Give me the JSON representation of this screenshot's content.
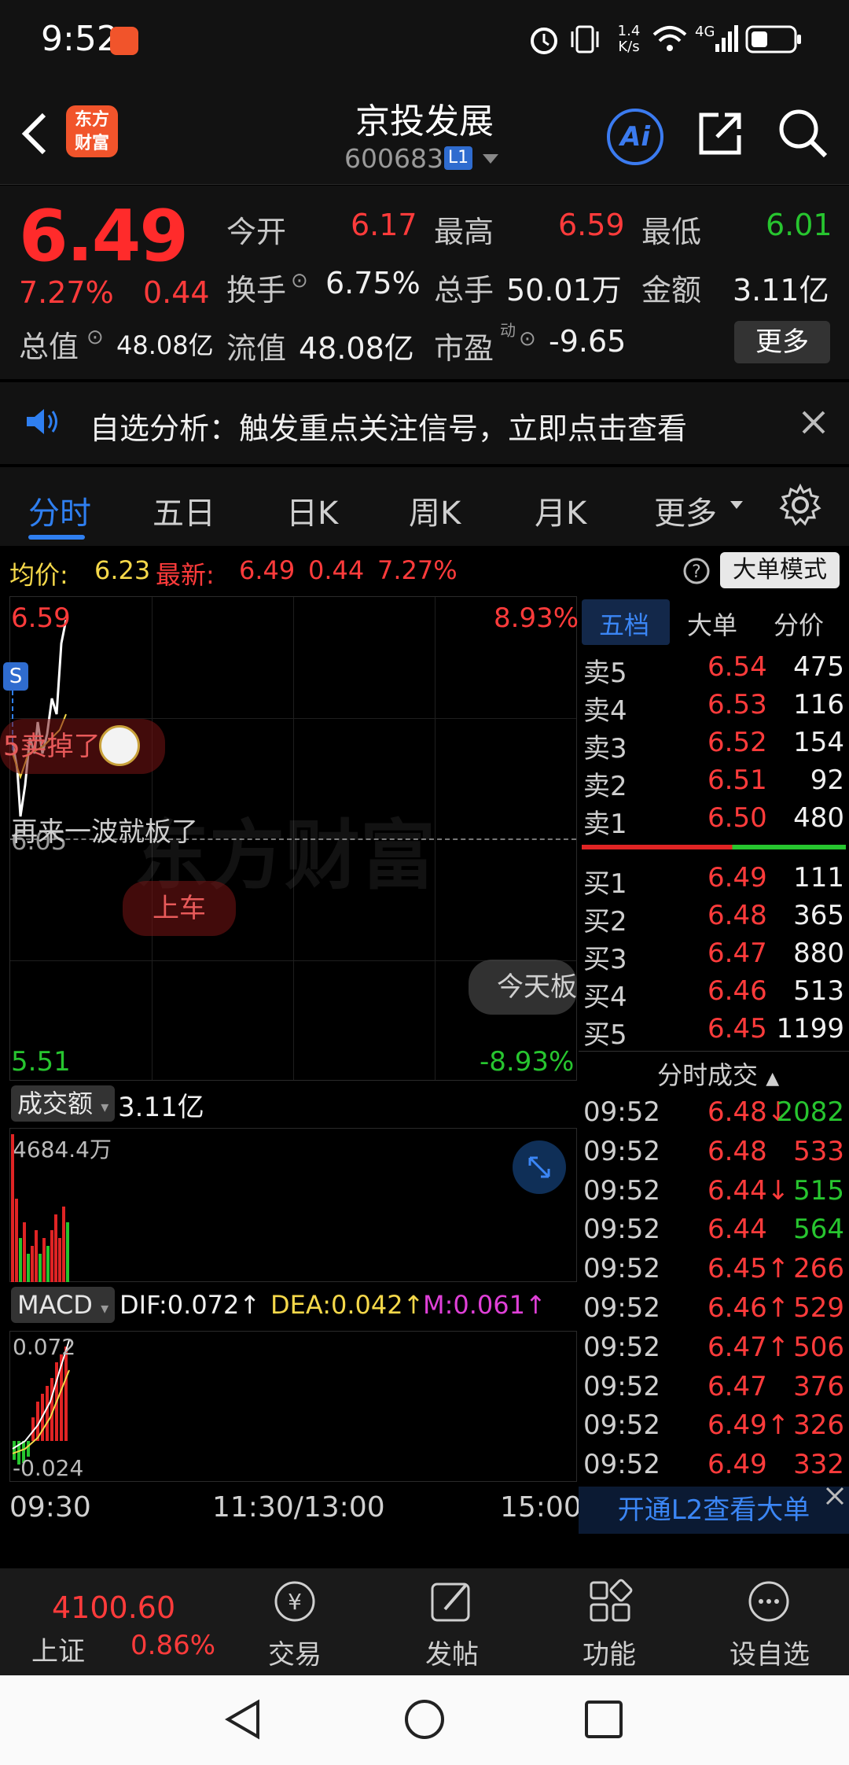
{
  "status_bar": {
    "time": "9:52",
    "net_speed_top": "1.4",
    "net_speed_bottom": "K/s",
    "network": "4G"
  },
  "header": {
    "logo_line1": "东方",
    "logo_line2": "财富",
    "title": "京投发展",
    "code": "600683",
    "level_badge": "L1",
    "ai_label": "Ai"
  },
  "quote": {
    "price": "6.49",
    "change_pct": "7.27%",
    "change": "0.44",
    "open_label": "今开",
    "open": "6.17",
    "high_label": "最高",
    "high": "6.59",
    "low_label": "最低",
    "low": "6.01",
    "turnover_label": "换手",
    "turnover": "6.75%",
    "volume_label": "总手",
    "volume": "50.01万",
    "amount_label": "金额",
    "amount": "3.11亿",
    "mktcap_label": "总值",
    "mktcap": "48.08亿",
    "float_label": "流值",
    "float": "48.08亿",
    "pe_label": "市盈",
    "pe_sup": "动",
    "pe": "-9.65",
    "more_label": "更多"
  },
  "notice": {
    "text": "自选分析：触发重点关注信号，立即点击查看"
  },
  "tabs": [
    "分时",
    "五日",
    "日K",
    "周K",
    "月K",
    "更多"
  ],
  "info_line": {
    "avg_label": "均价:",
    "avg": "6.23",
    "latest_label": "最新:",
    "latest": "6.49",
    "change": "0.44",
    "change_pct": "7.27%",
    "mode_button": "大单模式"
  },
  "chart": {
    "top_price": "6.59",
    "top_pct": "8.93%",
    "bottom_price": "5.51",
    "bottom_pct": "-8.93%",
    "mid_price": "6.05",
    "s_marker": "S",
    "bubble1": "5卖掉了",
    "bubble2": "再来一波就板了",
    "bubble3": "上车",
    "bubble4": "今天板",
    "watermark": "东方财富",
    "volume_selector": "成交额",
    "volume_total": "3.11亿",
    "volume_max": "4684.4万",
    "macd_selector": "MACD",
    "dif": "DIF:0.072↑",
    "dea": "DEA:0.042↑",
    "m": "M:0.061↑",
    "macd_top": "0.072",
    "macd_bottom": "-0.024",
    "time_start": "09:30",
    "time_mid": "11:30/13:00",
    "time_end": "15:00"
  },
  "orderbook": {
    "tabs": [
      "五档",
      "大单",
      "分价"
    ],
    "asks": [
      {
        "label": "卖5",
        "price": "6.54",
        "vol": "475"
      },
      {
        "label": "卖4",
        "price": "6.53",
        "vol": "116"
      },
      {
        "label": "卖3",
        "price": "6.52",
        "vol": "154"
      },
      {
        "label": "卖2",
        "price": "6.51",
        "vol": "92"
      },
      {
        "label": "卖1",
        "price": "6.50",
        "vol": "480"
      }
    ],
    "bids": [
      {
        "label": "买1",
        "price": "6.49",
        "vol": "111"
      },
      {
        "label": "买2",
        "price": "6.48",
        "vol": "365"
      },
      {
        "label": "买3",
        "price": "6.47",
        "vol": "880"
      },
      {
        "label": "买4",
        "price": "6.46",
        "vol": "513"
      },
      {
        "label": "买5",
        "price": "6.45",
        "vol": "1199"
      }
    ],
    "ticks_title": "分时成交",
    "ticks": [
      {
        "time": "09:52",
        "price": "6.48↓",
        "vol": "2082",
        "vc": "green"
      },
      {
        "time": "09:52",
        "price": "6.48",
        "vol": "533",
        "vc": "red"
      },
      {
        "time": "09:52",
        "price": "6.44↓",
        "vol": "515",
        "vc": "green"
      },
      {
        "time": "09:52",
        "price": "6.44",
        "vol": "564",
        "vc": "green"
      },
      {
        "time": "09:52",
        "price": "6.45↑",
        "vol": "266",
        "vc": "red"
      },
      {
        "time": "09:52",
        "price": "6.46↑",
        "vol": "529",
        "vc": "red"
      },
      {
        "time": "09:52",
        "price": "6.47↑",
        "vol": "506",
        "vc": "red"
      },
      {
        "time": "09:52",
        "price": "6.47",
        "vol": "376",
        "vc": "red"
      },
      {
        "time": "09:52",
        "price": "6.49↑",
        "vol": "326",
        "vc": "red"
      },
      {
        "time": "09:52",
        "price": "6.49",
        "vol": "332",
        "vc": "red"
      }
    ],
    "l2_banner": "开通L2查看大单"
  },
  "bottom_nav": {
    "index_value": "4100.60",
    "index_name": "上证",
    "index_pct": "0.86%",
    "items": [
      "交易",
      "发帖",
      "功能",
      "设自选"
    ]
  },
  "colors": {
    "up": "#ff3b3b",
    "down": "#27c52f",
    "accent": "#2f7ff0"
  }
}
